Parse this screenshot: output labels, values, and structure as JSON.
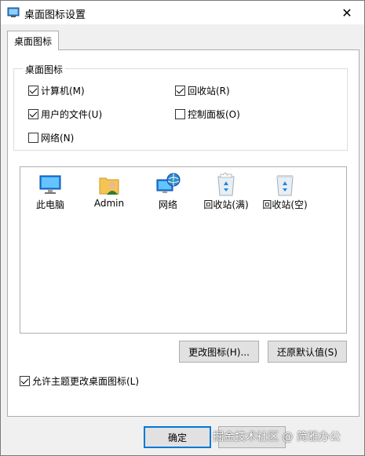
{
  "window": {
    "title": "桌面图标设置",
    "close_glyph": "✕"
  },
  "tabs": [
    {
      "label": "桌面图标"
    }
  ],
  "group": {
    "title": "桌面图标",
    "checkboxes": [
      {
        "label": "计算机(M)",
        "checked": true
      },
      {
        "label": "回收站(R)",
        "checked": true
      },
      {
        "label": "用户的文件(U)",
        "checked": true
      },
      {
        "label": "控制面板(O)",
        "checked": false
      },
      {
        "label": "网络(N)",
        "checked": false
      }
    ]
  },
  "icons": [
    {
      "label": "此电脑",
      "icon": "computer-icon"
    },
    {
      "label": "Admin",
      "icon": "user-folder-icon"
    },
    {
      "label": "网络",
      "icon": "network-icon"
    },
    {
      "label": "回收站(满)",
      "icon": "recycle-bin-full-icon"
    },
    {
      "label": "回收站(空)",
      "icon": "recycle-bin-empty-icon"
    }
  ],
  "buttons": {
    "change_icon": "更改图标(H)...",
    "restore_default": "还原默认值(S)",
    "ok": "确定"
  },
  "allow_theme": {
    "label": "允许主题更改桌面图标(L)",
    "checked": true
  },
  "watermark": "掘金技术社区 @ 简雅办公"
}
